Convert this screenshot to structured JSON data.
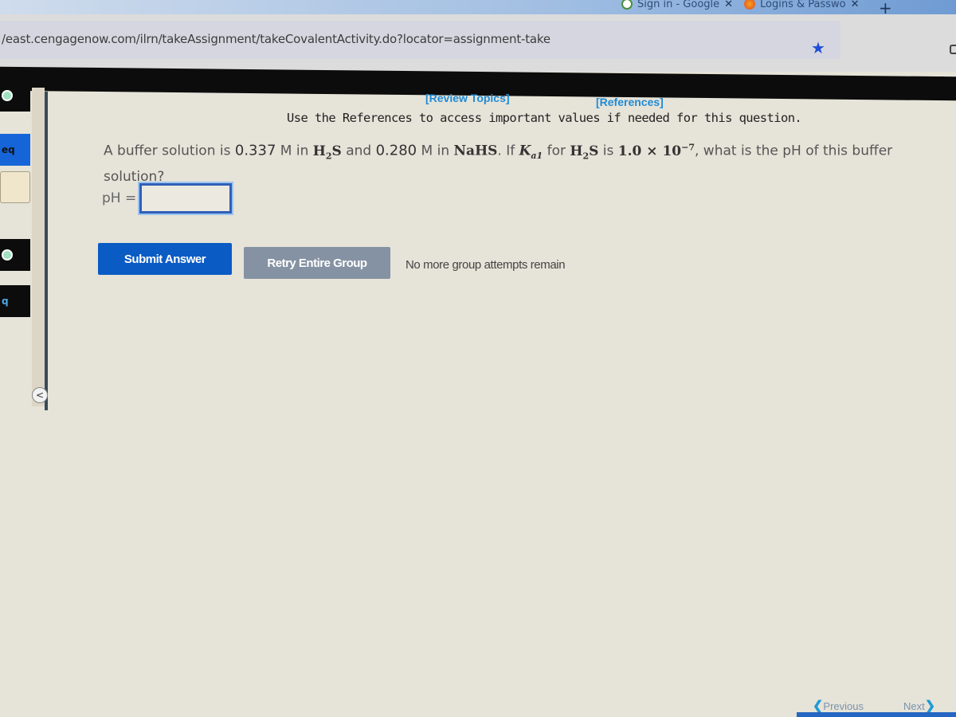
{
  "browser": {
    "tabs": [
      {
        "label": "Sign in - Google",
        "icon": "google-icon"
      },
      {
        "label": "Logins & Passwo",
        "icon": "firefox-icon"
      }
    ],
    "new_tab_symbol": "+",
    "close_symbol": "✕",
    "url": "/east.cengagenow.com/ilrn/takeAssignment/takeCovalentActivity.do?locator=assignment-take",
    "bookmark_symbol": "★"
  },
  "sidebar": {
    "items": [
      {
        "label": "",
        "type": "badge"
      },
      {
        "label": "eq",
        "type": "active"
      },
      {
        "label": "",
        "type": "empty"
      },
      {
        "label": "",
        "type": "badge"
      },
      {
        "label": "q",
        "type": "dark"
      }
    ],
    "collapse_symbol": "<"
  },
  "links": {
    "review_topics": "[Review Topics]",
    "references": "[References]"
  },
  "instruction": "Use the References to access important values if needed for this question.",
  "question": {
    "p1": "A buffer solution is ",
    "c1": "0.337",
    "u1": " M in ",
    "acid": "H",
    "acid_sub": "2",
    "acid_end": "S",
    "p2": " and ",
    "c2": "0.280",
    "u2": " M in ",
    "salt": "NaHS",
    "p3": ". If ",
    "k": "K",
    "k_sub": "a1",
    "p4": " for ",
    "acid2": "H",
    "acid2_sub": "2",
    "acid2_end": "S",
    "p5": " is ",
    "ka_mant": "1.0 × 10",
    "ka_exp": "−7",
    "p6": ", what is the pH of this buffer solution?"
  },
  "answer": {
    "label": "pH =",
    "value": ""
  },
  "buttons": {
    "submit": "Submit Answer",
    "retry": "Retry Entire Group"
  },
  "status": "No more group attempts remain",
  "nav": {
    "previous": "Previous",
    "next": "Next"
  }
}
